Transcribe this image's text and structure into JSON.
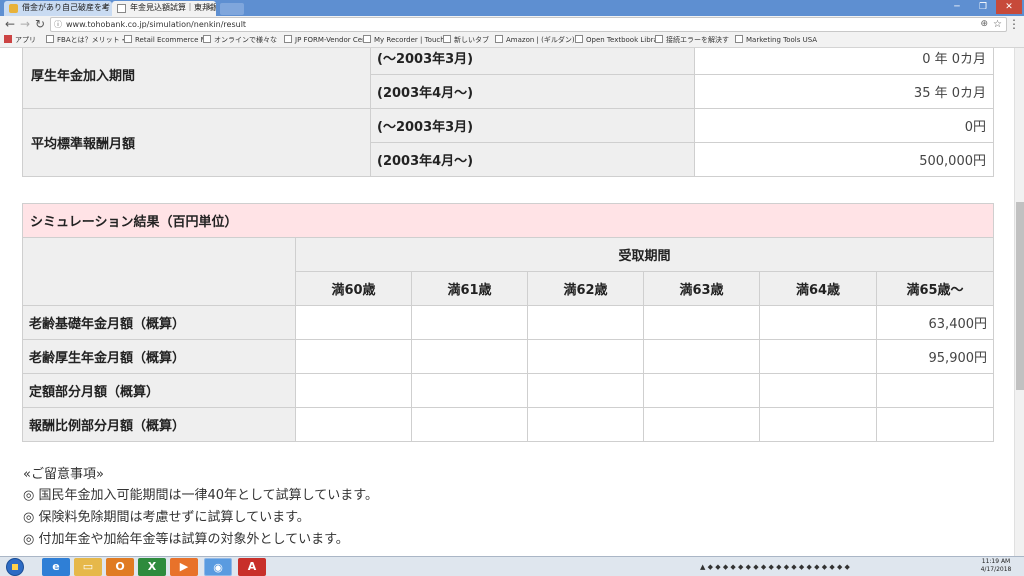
{
  "browser": {
    "tabs": [
      {
        "title": "借金があり自己破産を考"
      },
      {
        "title": "年金見込額試算｜東邦銀"
      }
    ],
    "url": "www.tohobank.co.jp/simulation/nenkin/result",
    "bookmarks": [
      "アプリ",
      "FBAとは？メリット・",
      "Retail Ecommerce Mi",
      "オンラインで様々な",
      "JP FORM-Vendor Cen",
      "My Recorder | Touch",
      "新しいタブ",
      "Amazon | (ギルダン)",
      "Open Textbook Libra",
      "接続エラーを解決す",
      "Marketing Tools USA"
    ]
  },
  "pension_table": {
    "rows": [
      {
        "header": "厚生年金加入期間",
        "items": [
          {
            "label": "(～2003年3月)",
            "value": "0 年 0カ月"
          },
          {
            "label": "(2003年4月～)",
            "value": "35 年 0カ月"
          }
        ]
      },
      {
        "header": "平均標準報酬月額",
        "items": [
          {
            "label": "(～2003年3月)",
            "value": "0円"
          },
          {
            "label": "(2003年4月～)",
            "value": "500,000円"
          }
        ]
      }
    ]
  },
  "simulation": {
    "title": "シミュレーション結果（百円単位）",
    "group_header": "受取期間",
    "ages": [
      "満60歳",
      "満61歳",
      "満62歳",
      "満63歳",
      "満64歳",
      "満65歳～"
    ],
    "rows": [
      {
        "label": "老齢基礎年金月額（概算）",
        "values": [
          "",
          "",
          "",
          "",
          "",
          "63,400円"
        ]
      },
      {
        "label": "老齢厚生年金月額（概算）",
        "values": [
          "",
          "",
          "",
          "",
          "",
          "95,900円"
        ]
      },
      {
        "label": "定額部分月額（概算）",
        "values": [
          "",
          "",
          "",
          "",
          "",
          ""
        ]
      },
      {
        "label": "報酬比例部分月額（概算）",
        "values": [
          "",
          "",
          "",
          "",
          "",
          ""
        ]
      }
    ]
  },
  "notes": {
    "heading": "«ご留意事項»",
    "items": [
      "◎ 国民年金加入可能期間は一律40年として試算しています。",
      "◎ 保険料免除期間は考慮せずに試算しています。",
      "◎ 付加年金や加給年金等は試算の対象外としています。"
    ]
  },
  "taskbar": {
    "clock_time": "11:19 AM",
    "clock_date": "4/17/2018"
  }
}
